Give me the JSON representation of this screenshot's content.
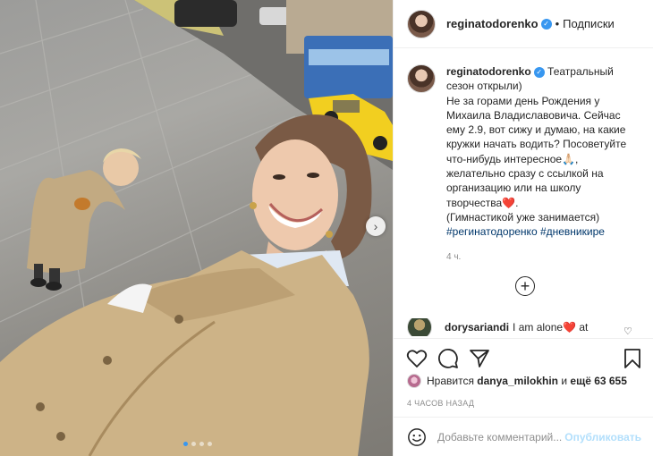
{
  "post": {
    "username": "reginatodorenko",
    "follow_label": "Подписки",
    "dot_separator": "•",
    "caption_lines": [
      "Театральный",
      "сезон открыли)",
      "Не за горами день Рождения у",
      "Михаила Владиславовича. Сейчас",
      "ему 2.9, вот сижу и думаю, на какие",
      "кружки начать водить? Посоветуйте",
      "что-нибудь интересное🙏🏻,",
      "желательно сразу с ссылкой на",
      "организацию или на школу",
      "творчества❤️.",
      "(Гимнастикой уже занимается)"
    ],
    "hashtags": "#регинатодоренко #дневникире",
    "time_ago": "4 ч.",
    "verified_mark": "✓"
  },
  "comment": {
    "username": "dorysariandi",
    "text": "I am alone❤️ at"
  },
  "likes": {
    "prefix": "Нравится",
    "liker": "danya_milokhin",
    "middle": "и",
    "more": "ещё 63 655"
  },
  "posted_ago": "4 ЧАСОВ НАЗАД",
  "add_comment": {
    "placeholder": "Добавьте комментарий...",
    "publish_label": "Опубликовать"
  },
  "icons": {
    "load_more": "plus-circle-icon",
    "carousel_next": "chevron-right-icon",
    "like": "heart-icon",
    "comment": "comment-icon",
    "share": "send-icon",
    "save": "bookmark-icon",
    "emoji": "emoji-icon"
  },
  "colors": {
    "accent": "#3897f0",
    "hashtag": "#00376b",
    "publish_disabled": "#b2dffc",
    "muted": "#8e8e8e"
  },
  "carousel": {
    "total": 4,
    "active": 1
  }
}
